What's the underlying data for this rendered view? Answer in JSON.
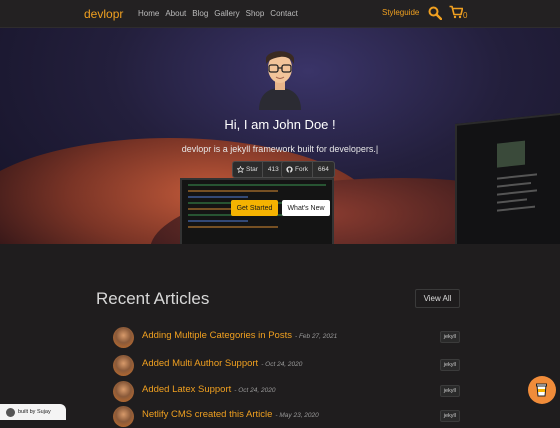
{
  "nav": {
    "brand": "devlopr",
    "links": [
      "Home",
      "About",
      "Blog",
      "Gallery",
      "Shop",
      "Contact"
    ],
    "styleguide": "Styleguide",
    "cart_count": "0",
    "icons": {
      "search": "search-icon",
      "cart": "cart-icon"
    }
  },
  "hero": {
    "title": "Hi, I am John Doe !",
    "subtitle": "devlopr is a jekyll framework built for developers.|",
    "github": {
      "star_label": "Star",
      "star_count": "413",
      "fork_label": "Fork",
      "fork_count": "664"
    },
    "get_started": "Get Started",
    "whats_new": "What's New"
  },
  "articles": {
    "heading": "Recent Articles",
    "view_all": "View All",
    "items": [
      {
        "title": "Adding Multiple Categories in Posts",
        "date": "- Feb 27, 2021",
        "tag": "jekyll"
      },
      {
        "title": "Added Multi Author Support",
        "date": "- Oct 24, 2020",
        "tag": "jekyll"
      },
      {
        "title": "Added Latex Support",
        "date": "- Oct 24, 2020",
        "tag": "jekyll"
      },
      {
        "title": "Netlify CMS created this Article",
        "date": "- May 23, 2020",
        "tag": "jekyll"
      }
    ]
  },
  "footer_badge": {
    "text": "built by Sujay"
  },
  "colors": {
    "accent": "#f0a020",
    "button_yellow": "#f5b301",
    "background": "#1f1d1e"
  }
}
